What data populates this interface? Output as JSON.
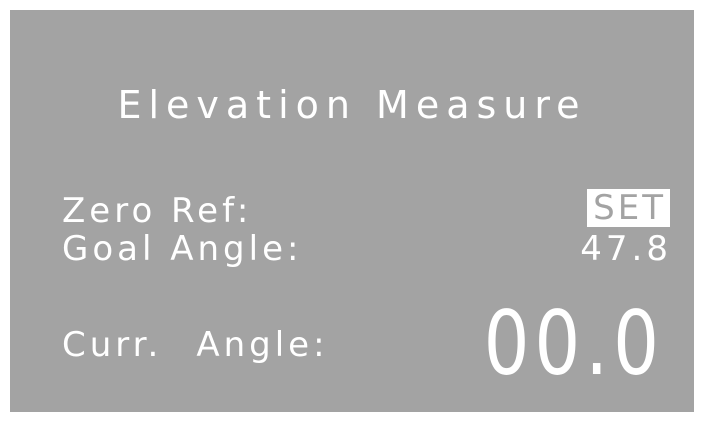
{
  "display": {
    "background_color": "#a3a3a3",
    "text_color": "#ffffff",
    "title": "Elevation Measure",
    "zero_ref": {
      "label": "Zero Ref:",
      "value": "SET"
    },
    "goal_angle": {
      "label": "Goal Angle:",
      "value": "47.8"
    },
    "current_angle": {
      "label_part1": "Curr.",
      "label_part2": "Angle:",
      "value": "00.0"
    }
  }
}
